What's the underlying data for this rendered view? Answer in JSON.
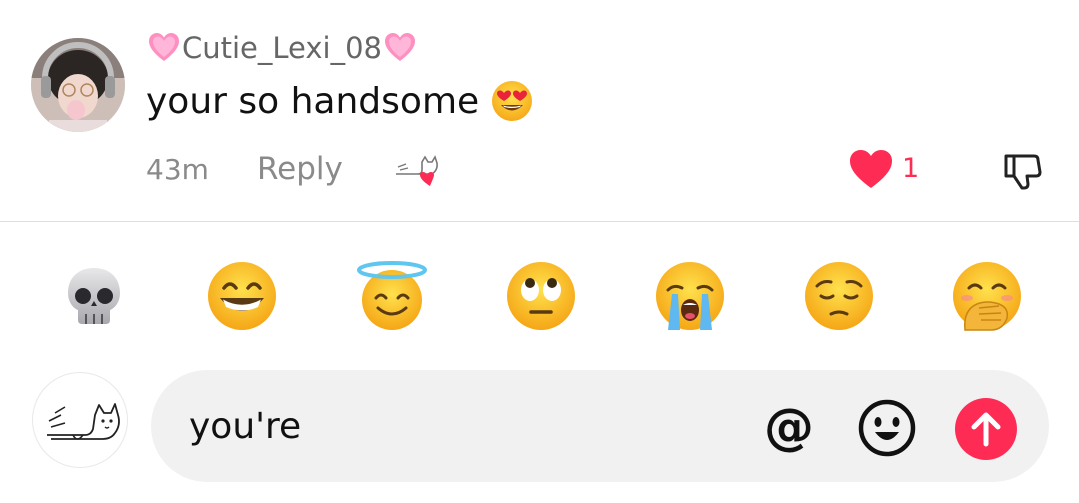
{
  "comment": {
    "username": "Cutie_Lexi_08",
    "text": "your so handsome",
    "text_emoji_icon": "heart-eyes-face-icon",
    "time": "43m",
    "reply_label": "Reply",
    "like_count": "1",
    "accent_color": "#fe2c55"
  },
  "emoji_bar": [
    "skull",
    "grinning-face",
    "smiling-face-with-halo",
    "face-with-rolling-eyes",
    "loudly-crying-face",
    "pensive-face",
    "face-with-hand-over-mouth"
  ],
  "input": {
    "value": "you're"
  }
}
